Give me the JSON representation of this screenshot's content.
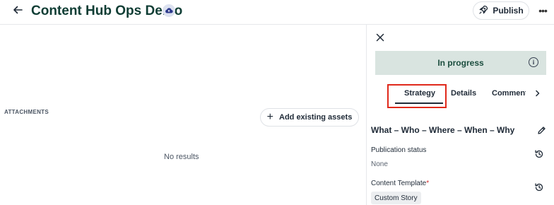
{
  "header": {
    "title": "Content Hub Ops Demo",
    "publish_label": "Publish",
    "more_label": "•••"
  },
  "attachments": {
    "section_label": "ATTACHMENTS",
    "add_label": "Add existing assets",
    "empty_text": "No results"
  },
  "panel": {
    "status": "In progress",
    "info_glyph": "i",
    "tabs": [
      "Strategy",
      "Details",
      "Comments"
    ],
    "active_tab": "Strategy",
    "section_title": "What – Who – Where – When – Why",
    "fields": {
      "publication_status": {
        "label": "Publication status",
        "value": "None"
      },
      "content_template": {
        "label": "Content Template",
        "required_mark": "*",
        "value": "Custom Story"
      }
    }
  },
  "colors": {
    "title": "#0f3d34",
    "status_bg": "#d9e4e0",
    "status_text": "#1b4d3e",
    "highlight_border": "#e0291b"
  },
  "icons": [
    "back-arrow-icon",
    "cloud-sync-icon",
    "rocket-icon",
    "more-horizontal-icon",
    "close-icon",
    "info-icon",
    "chevron-right-icon",
    "pencil-icon",
    "history-icon"
  ]
}
